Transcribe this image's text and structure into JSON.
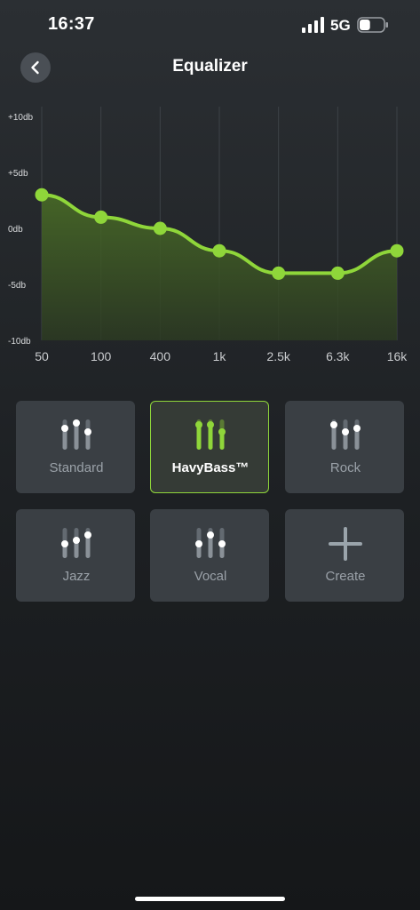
{
  "status_bar": {
    "time": "16:37",
    "network": "5G",
    "battery_level": 0.45
  },
  "header": {
    "title": "Equalizer",
    "back_icon": "chevron-left-icon"
  },
  "equalizer": {
    "db_labels": [
      "+10db",
      "+5db",
      "0db",
      "-5db",
      "-10db"
    ],
    "bands": [
      {
        "freq": "50",
        "gain_db": 3
      },
      {
        "freq": "100",
        "gain_db": 1
      },
      {
        "freq": "400",
        "gain_db": 0
      },
      {
        "freq": "1k",
        "gain_db": -2
      },
      {
        "freq": "2.5k",
        "gain_db": -4
      },
      {
        "freq": "6.3k",
        "gain_db": -4
      },
      {
        "freq": "16k",
        "gain_db": -2
      }
    ],
    "range_db": [
      -10,
      10
    ],
    "accent_color": "#8fd63a"
  },
  "presets": [
    {
      "label": "Standard",
      "selected": false,
      "icon": "sliders-standard-icon"
    },
    {
      "label": "HavyBass™",
      "selected": true,
      "icon": "sliders-bass-icon"
    },
    {
      "label": "Rock",
      "selected": false,
      "icon": "sliders-rock-icon"
    },
    {
      "label": "Jazz",
      "selected": false,
      "icon": "sliders-jazz-icon"
    },
    {
      "label": "Vocal",
      "selected": false,
      "icon": "sliders-vocal-icon"
    },
    {
      "label": "Create",
      "selected": false,
      "icon": "plus-icon"
    }
  ]
}
